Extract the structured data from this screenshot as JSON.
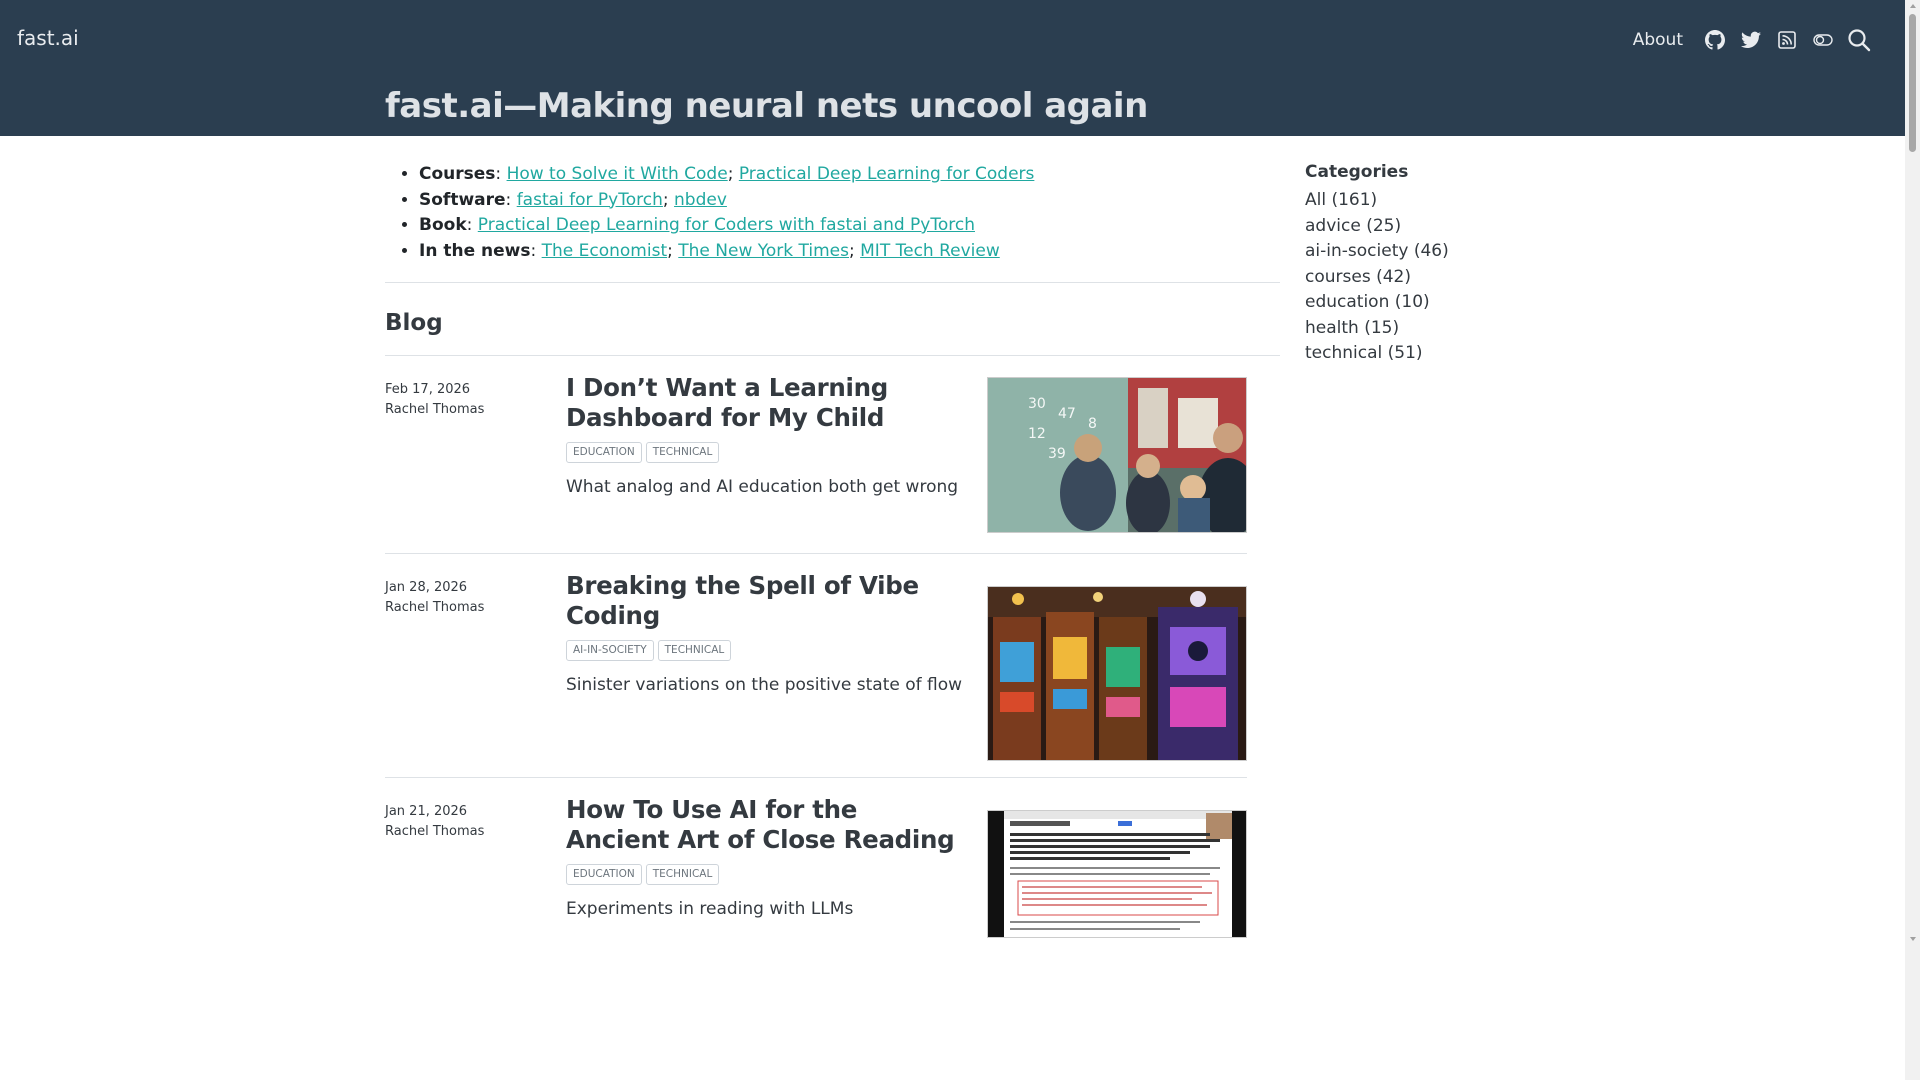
{
  "header": {
    "brand": "fast.ai",
    "about_label": "About",
    "icons": [
      "github-icon",
      "twitter-icon",
      "rss-icon",
      "toggle-icon",
      "search-icon"
    ],
    "banner_title": "fast.ai—Making neural nets uncool again",
    "bg_color": "#2b3e50"
  },
  "intro": {
    "courses_label": "Courses",
    "courses_links": [
      "How to Solve it With Code",
      "Practical Deep Learning for Coders"
    ],
    "software_label": "Software",
    "software_links": [
      "fastai for PyTorch",
      "nbdev"
    ],
    "book_label": "Book",
    "book_links": [
      "Practical Deep Learning for Coders with fastai and PyTorch"
    ],
    "news_label": "In the news",
    "news_links": [
      "The Economist",
      "The New York Times",
      "MIT Tech Review"
    ],
    "link_color": "#20a8a0"
  },
  "blog": {
    "heading": "Blog",
    "posts": [
      {
        "date": "Feb 17, 2026",
        "author": "Rachel Thomas",
        "title": "I Don’t Want a Learning Dashboard for My Child",
        "tags": [
          "EDUCATION",
          "TECHNICAL"
        ],
        "description": "What analog and AI education both get wrong"
      },
      {
        "date": "Jan 28, 2026",
        "author": "Rachel Thomas",
        "title": "Breaking the Spell of Vibe Coding",
        "tags": [
          "AI-IN-SOCIETY",
          "TECHNICAL"
        ],
        "description": "Sinister variations on the positive state of flow"
      },
      {
        "date": "Jan 21, 2026",
        "author": "Rachel Thomas",
        "title": "How To Use AI for the Ancient Art of Close Reading",
        "tags": [
          "EDUCATION",
          "TECHNICAL"
        ],
        "description": "Experiments in reading with LLMs"
      }
    ]
  },
  "sidebar": {
    "title": "Categories",
    "categories": [
      "All (161)",
      "advice (25)",
      "ai-in-society (46)",
      "courses (42)",
      "education (10)",
      "health (15)",
      "technical (51)"
    ]
  }
}
